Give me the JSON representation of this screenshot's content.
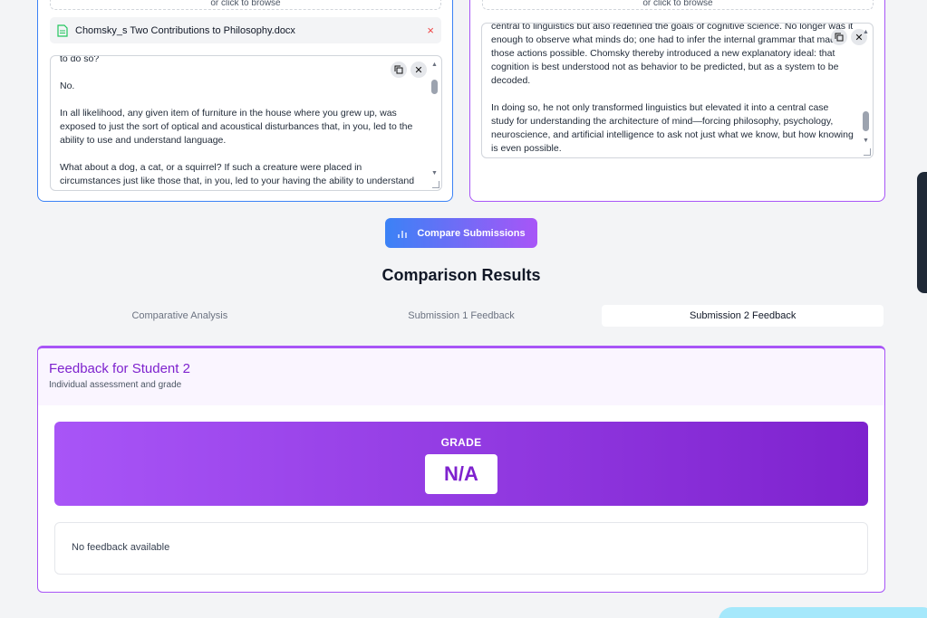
{
  "submission1": {
    "dropzone_text": "or click to browse",
    "file_name": "Chomsky_s Two Contributions to Philosophy.docx",
    "remove_symbol": "×",
    "copy_icon": "copy-icon",
    "clear_symbol": "✕",
    "text": "to do so?\n\nNo.\n\nIn all likelihood, any given item of furniture in the house where you grew up, was exposed to just the sort of optical and acoustical disturbances that, in you, led to the ability to use and understand language.\n\nWhat about a dog, a cat, or a squirrel? If such a creature were placed in circumstances just like those that, in you, led to your having the ability to understand these very"
  },
  "submission2": {
    "dropzone_text": "or click to browse",
    "copy_icon": "copy-icon",
    "clear_symbol": "✕",
    "text": "central to linguistics but also redefined the goals of cognitive science. No longer was it enough to observe what minds do; one had to infer the internal grammar that made those actions possible. Chomsky thereby introduced a new explanatory ideal: that cognition is best understood not as behavior to be predicted, but as a system to be decoded.\n\nIn doing so, he not only transformed linguistics but elevated it into a central case study for understanding the architecture of mind—forcing philosophy, psychology, neuroscience, and artificial intelligence to ask not just what we know, but how knowing is even possible."
  },
  "compare_button": {
    "label": "Compare Submissions",
    "icon": "bar-chart-icon"
  },
  "results": {
    "title": "Comparison Results",
    "tabs": [
      {
        "label": "Comparative Analysis",
        "active": false
      },
      {
        "label": "Submission 1 Feedback",
        "active": false
      },
      {
        "label": "Submission 2 Feedback",
        "active": true
      }
    ]
  },
  "feedback": {
    "title": "Feedback for Student 2",
    "subtitle": "Individual assessment and grade",
    "grade_label": "GRADE",
    "grade_value": "N/A",
    "feedback_text": "No feedback available"
  },
  "colors": {
    "blue": "#3b82f6",
    "purple": "#a855f7",
    "deep_purple": "#7e22ce"
  }
}
